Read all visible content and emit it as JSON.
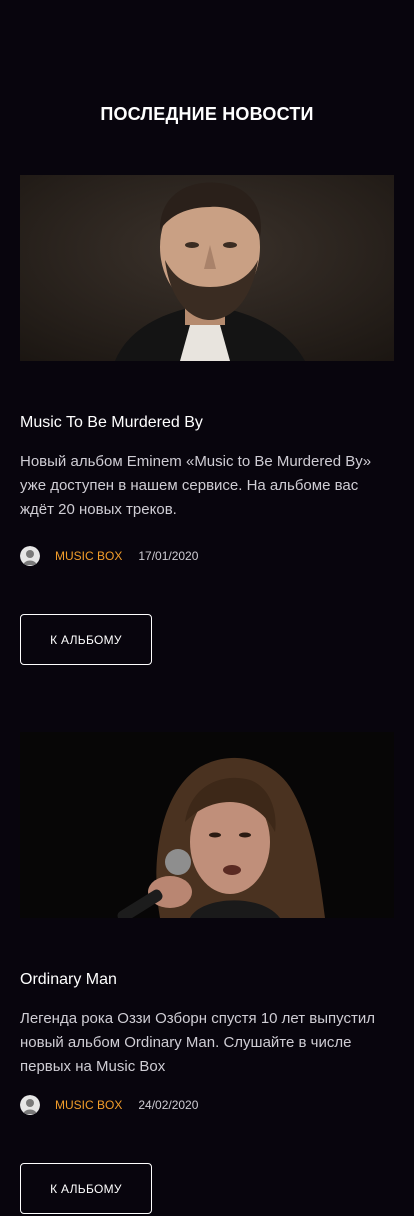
{
  "section": {
    "title": "ПОСЛЕДНИЕ НОВОСТИ"
  },
  "articles": [
    {
      "title": "Music To Be Murdered By",
      "description": "Новый альбом Eminem «Music to Be Murdered By» уже доступен в нашем сервисе. На альбоме вас ждёт 20 новых треков.",
      "author": "MUSIC BOX",
      "date": "17/01/2020",
      "button_label": "К АЛЬБОМУ"
    },
    {
      "title": "Ordinary Man",
      "description": "Легенда рока Оззи Озборн спустя 10 лет выпустил новый альбом Ordinary Man. Слушайте в числе первых на Music Box",
      "author": "MUSIC BOX",
      "date": "24/02/2020",
      "button_label": "К АЛЬБОМУ"
    }
  ],
  "colors": {
    "background": "#08050d",
    "accent": "#f29d2a",
    "text": "#ffffff",
    "muted_text": "#cfcdd4"
  }
}
